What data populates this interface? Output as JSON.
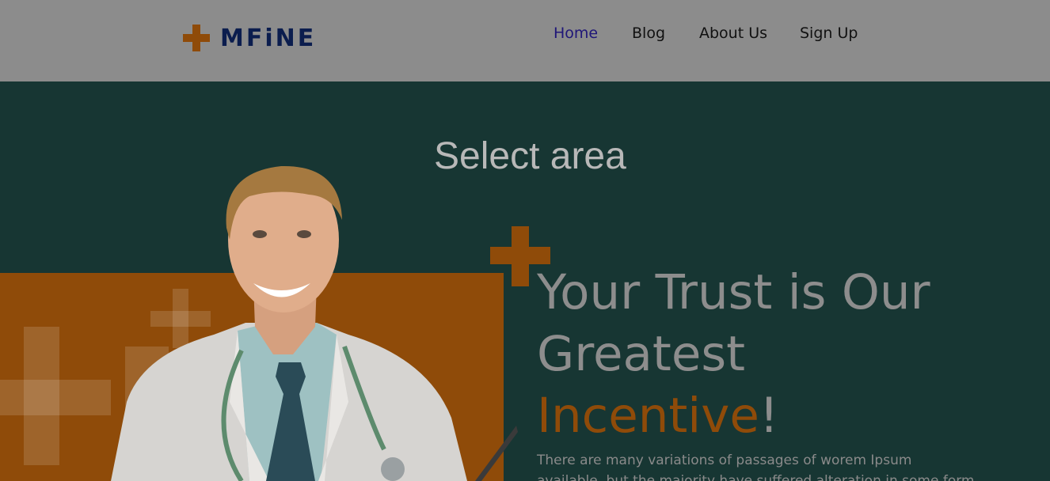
{
  "brand": {
    "name": "MFiNE",
    "logo_icon": "plus-icon"
  },
  "nav": {
    "items": [
      {
        "label": "Home",
        "active": true
      },
      {
        "label": "Blog",
        "active": false
      },
      {
        "label": "About Us",
        "active": false
      },
      {
        "label": "Sign Up",
        "active": false
      }
    ]
  },
  "overlay": {
    "label": "Select area"
  },
  "hero": {
    "headline_line1": "Your Trust is Our",
    "headline_line2": "Greatest",
    "headline_accent": "Incentive",
    "headline_end": "!",
    "paragraph": "There are many variations of passages of worem Ipsum available, but the majority have suffered alteration in some form."
  },
  "colors": {
    "accent": "#8f4b09",
    "brand_navy": "#0b1d4e",
    "hero_bg": "#173633",
    "header_bg": "#8c8c8c",
    "nav_active": "#1f1678"
  }
}
